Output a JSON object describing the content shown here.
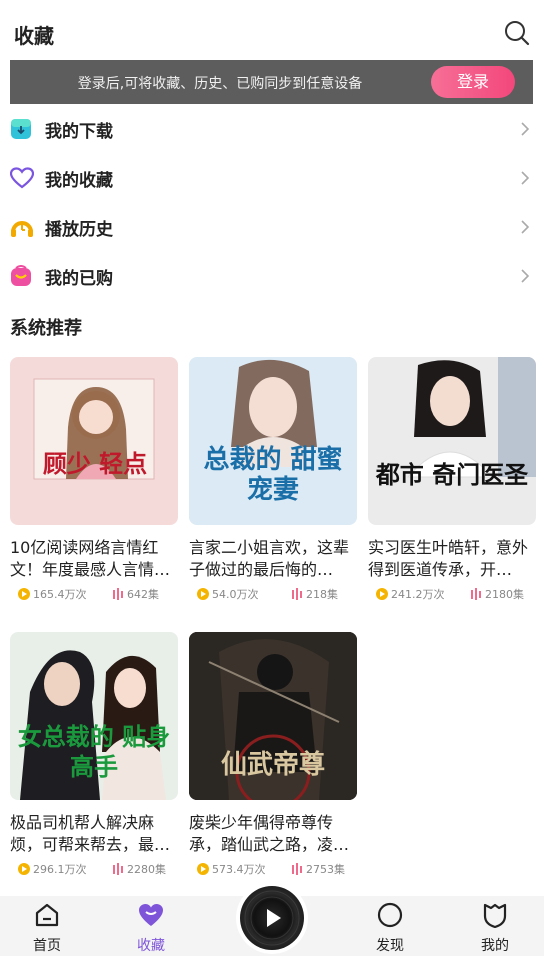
{
  "header": {
    "title": "收藏"
  },
  "login_bar": {
    "text": "登录后,可将收藏、历史、已购同步到任意设备",
    "button": "登录"
  },
  "menu": [
    {
      "label": "我的下载",
      "icon": "download-icon"
    },
    {
      "label": "我的收藏",
      "icon": "heart-icon"
    },
    {
      "label": "播放历史",
      "icon": "history-icon"
    },
    {
      "label": "我的已购",
      "icon": "purchased-icon"
    }
  ],
  "section": {
    "title": "系统推荐"
  },
  "books": [
    {
      "title": "10亿阅读网络言情红文！年度最感人言情…",
      "plays": "165.4万次",
      "episodes": "642集",
      "cover": {
        "bg": "#f3d6d6",
        "text": "顾少 轻点",
        "text_color": "#c0192b"
      }
    },
    {
      "title": "言家二小姐言欢，这辈子做过的最后悔的…",
      "plays": "54.0万次",
      "episodes": "218集",
      "cover": {
        "bg": "#dcecf6",
        "text": "总裁的 甜蜜宠妻",
        "text_color": "#1b6fa8"
      }
    },
    {
      "title": "实习医生叶皓轩，意外得到医道传承，开…",
      "plays": "241.2万次",
      "episodes": "2180集",
      "cover": {
        "bg": "#e9e9ea",
        "text": "都市 奇门医圣",
        "text_color": "#111111"
      }
    },
    {
      "title": "极品司机帮人解决麻烦，可帮来帮去，最…",
      "plays": "296.1万次",
      "episodes": "2280集",
      "cover": {
        "bg": "#eaf2ea",
        "text": "女总裁的 贴身高手",
        "text_color": "#1a9a3d"
      }
    },
    {
      "title": "废柴少年偶得帝尊传承，踏仙武之路，凌…",
      "plays": "573.4万次",
      "episodes": "2753集",
      "cover": {
        "bg": "#2a2520",
        "text": "仙武帝尊",
        "text_color": "#d9c7a0"
      }
    }
  ],
  "tabbar": [
    {
      "label": "首页",
      "icon": "home-icon"
    },
    {
      "label": "收藏",
      "icon": "favorites-icon"
    },
    {
      "label": "发现",
      "icon": "discover-icon"
    },
    {
      "label": "我的",
      "icon": "profile-icon"
    }
  ],
  "colors": {
    "accent": "#7e55d8",
    "login_button": "#f3477b",
    "plays_icon": "#f5b400",
    "episodes_icon": "#f06a8c"
  }
}
